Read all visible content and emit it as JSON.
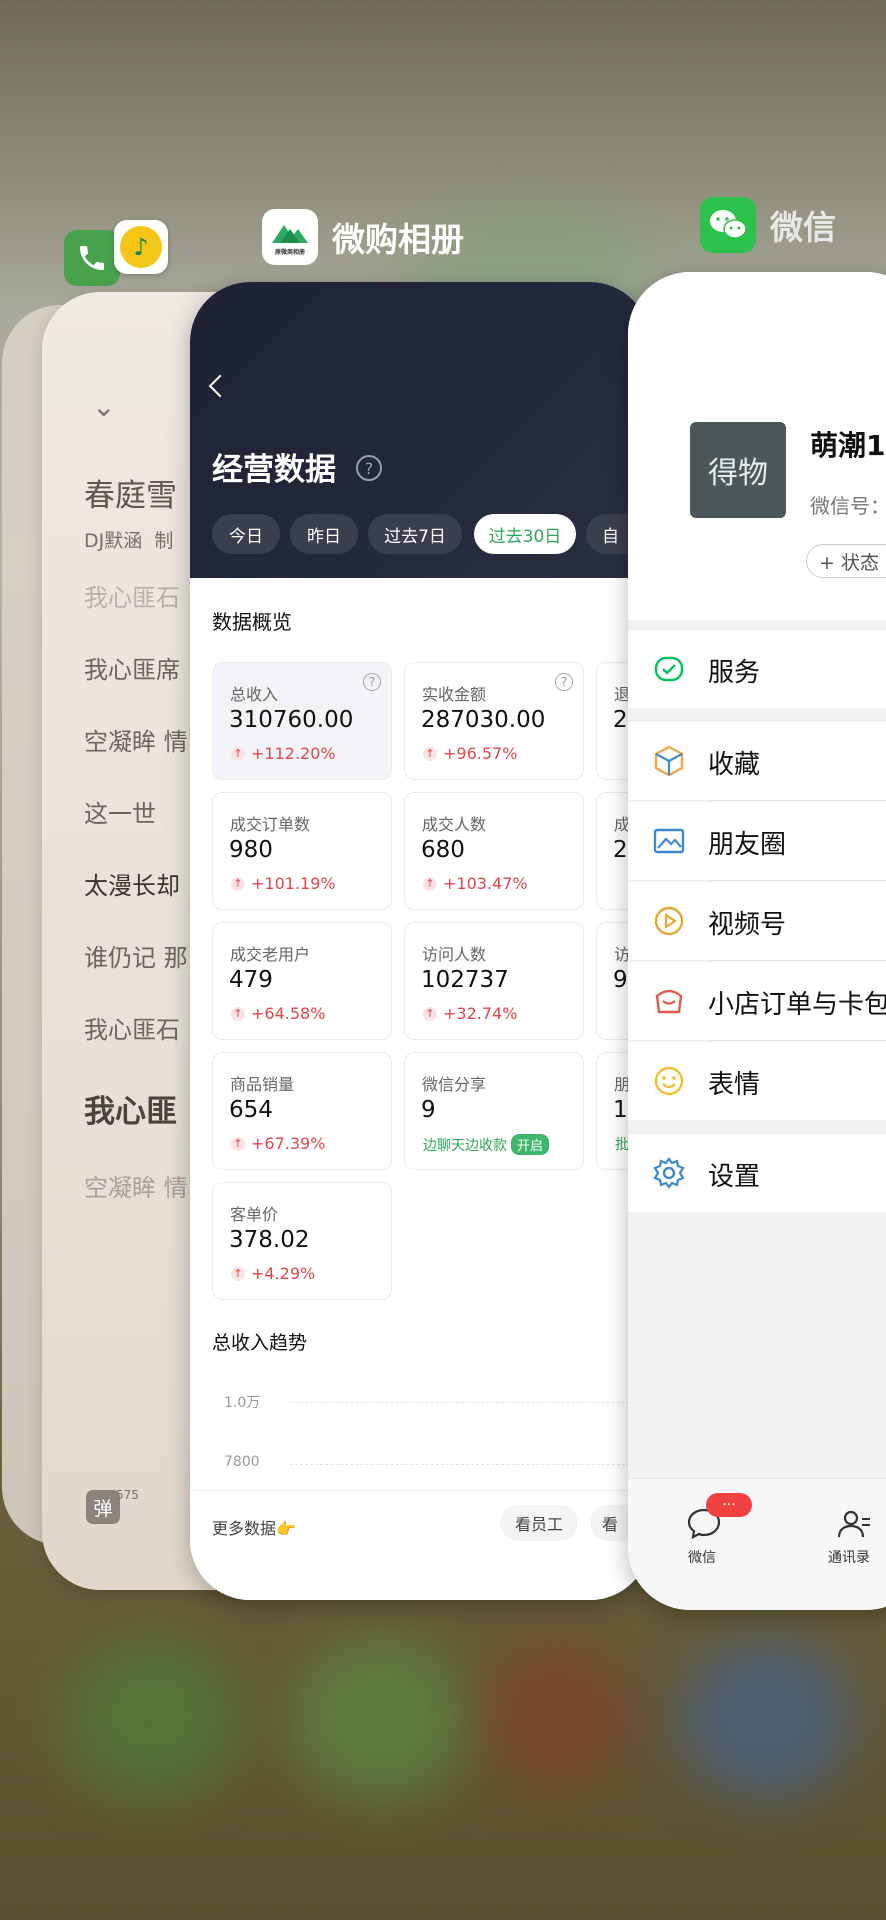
{
  "apps": {
    "music_label": "",
    "album_label": "微购相册",
    "album_icon_text": "原微商相册",
    "wechat_label": "微信"
  },
  "music": {
    "song_title": "春庭雪",
    "artist": "DJ默涵",
    "credit_partial": "制",
    "lyrics": [
      "我心匪石",
      "我心匪席",
      "空凝眸 情",
      "这一世",
      "太漫长却",
      "谁仍记 那",
      "我心匪石",
      "我心匪",
      "空凝眸 情"
    ],
    "danmu_count": "575",
    "danmu_label": "弹"
  },
  "data_page": {
    "title": "经营数据",
    "tabs": [
      "今日",
      "昨日",
      "过去7日",
      "过去30日",
      "自"
    ],
    "active_tab_index": 3,
    "overview_title": "数据概览",
    "metrics": [
      {
        "label": "总收入",
        "value": "310760.00",
        "change": "+112.20%"
      },
      {
        "label": "实收金额",
        "value": "287030.00",
        "change": "+96.57%"
      },
      {
        "label": "退",
        "value": "2",
        "change": ""
      },
      {
        "label": "成交订单数",
        "value": "980",
        "change": "+101.19%"
      },
      {
        "label": "成交人数",
        "value": "680",
        "change": "+103.47%"
      },
      {
        "label": "成",
        "value": "2",
        "change": ""
      },
      {
        "label": "成交老用户",
        "value": "479",
        "change": "+64.58%"
      },
      {
        "label": "访问人数",
        "value": "102737",
        "change": "+32.74%"
      },
      {
        "label": "访",
        "value": "9",
        "change": ""
      },
      {
        "label": "商品销量",
        "value": "654",
        "change": "+67.39%"
      },
      {
        "label": "微信分享",
        "value": "9",
        "change": ""
      },
      {
        "label": "朋",
        "value": "1",
        "change": ""
      },
      {
        "label": "客单价",
        "value": "378.02",
        "change": "+4.29%"
      }
    ],
    "share_note": "边聊天边收款",
    "share_badge": "开启",
    "batch_partial": "批",
    "trend_title": "总收入趋势",
    "trend_ticks": [
      "1.0万",
      "7800"
    ],
    "footer_more": "更多数据",
    "footer_more_emoji": "👉",
    "footer_staff": "看员工",
    "footer_partial": "看"
  },
  "wechat": {
    "profile_name": "萌潮1",
    "wechat_id_label": "微信号：",
    "avatar_text": "得物",
    "status_button": "+ 状态",
    "menu": [
      {
        "label": "服务",
        "icon": "service-icon",
        "color": "#07c160"
      },
      {
        "label": "收藏",
        "icon": "favorites-icon",
        "color": "#f0a64a"
      },
      {
        "label": "朋友圈",
        "icon": "moments-icon",
        "color": "#3d89c9"
      },
      {
        "label": "视频号",
        "icon": "channels-icon",
        "color": "#e5a632"
      },
      {
        "label": "小店订单与卡包",
        "icon": "shop-orders-icon",
        "color": "#e25a4d"
      },
      {
        "label": "表情",
        "icon": "sticker-icon",
        "color": "#efbf2f"
      },
      {
        "label": "设置",
        "icon": "settings-icon",
        "color": "#3d89c9"
      }
    ],
    "nav": [
      {
        "label": "微信",
        "badge": "···"
      },
      {
        "label": "通讯录",
        "badge": ""
      }
    ]
  }
}
